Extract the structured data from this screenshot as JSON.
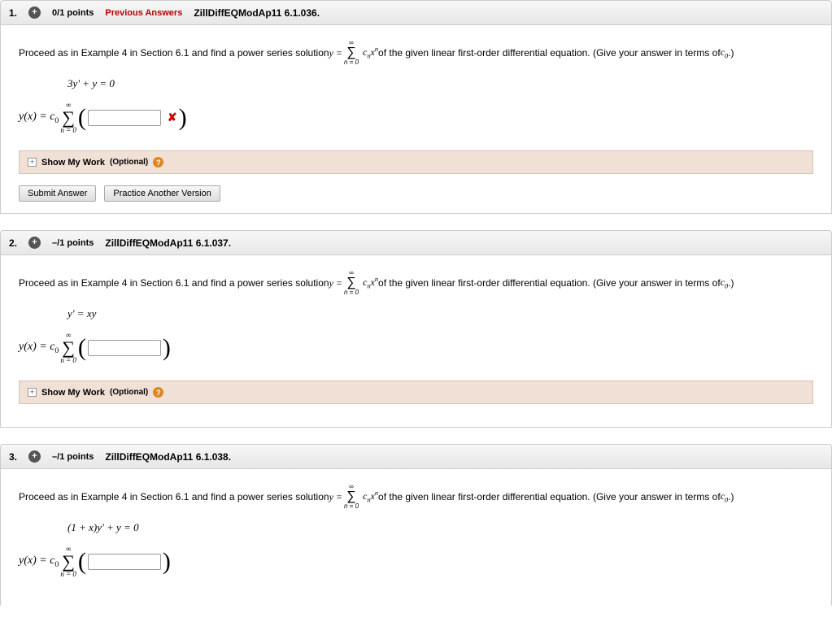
{
  "questions": [
    {
      "number": "1.",
      "points": "0/1 points",
      "previous_answers": "Previous Answers",
      "source": "ZillDiffEQModAp11 6.1.036.",
      "prompt_pre": "Proceed as in Example 4 in Section 6.1 and find a power series solution ",
      "prompt_eq_lhs": "y = ",
      "prompt_sum_top": "∞",
      "prompt_sum_bot": "n = 0",
      "prompt_sum_term": "cₙxⁿ",
      "prompt_post": " of the given linear first-order differential equation. (Give your answer in terms of ",
      "prompt_c0": "c₀",
      "prompt_close": ".)",
      "equation": "3y' + y = 0",
      "answer_prefix": "y(x) = c₀",
      "answer_status": "wrong",
      "show_work_label": "Show My Work",
      "show_work_opt": "(Optional)",
      "submit_label": "Submit Answer",
      "practice_label": "Practice Another Version"
    },
    {
      "number": "2.",
      "points": "–/1 points",
      "previous_answers": "",
      "source": "ZillDiffEQModAp11 6.1.037.",
      "prompt_pre": "Proceed as in Example 4 in Section 6.1 and find a power series solution ",
      "prompt_eq_lhs": "y = ",
      "prompt_sum_top": "∞",
      "prompt_sum_bot": "n = 0",
      "prompt_sum_term": "cₙxⁿ",
      "prompt_post": " of the given linear first-order differential equation. (Give your answer in terms of ",
      "prompt_c0": "c₀",
      "prompt_close": ".)",
      "equation": "y' = xy",
      "answer_prefix": "y(x) = c₀",
      "answer_status": "none",
      "show_work_label": "Show My Work",
      "show_work_opt": "(Optional)",
      "submit_label": "",
      "practice_label": ""
    },
    {
      "number": "3.",
      "points": "–/1 points",
      "previous_answers": "",
      "source": "ZillDiffEQModAp11 6.1.038.",
      "prompt_pre": "Proceed as in Example 4 in Section 6.1 and find a power series solution ",
      "prompt_eq_lhs": "y = ",
      "prompt_sum_top": "∞",
      "prompt_sum_bot": "n = 0",
      "prompt_sum_term": "cₙxⁿ",
      "prompt_post": " of the given linear first-order differential equation. (Give your answer in terms of ",
      "prompt_c0": "c₀",
      "prompt_close": ".)",
      "equation": "(1 + x)y' + y = 0",
      "answer_prefix": "y(x) = c₀",
      "answer_status": "none",
      "show_work_label": "",
      "show_work_opt": "",
      "submit_label": "",
      "practice_label": ""
    }
  ],
  "shared": {
    "sum_top": "∞",
    "sum_bot": "n = 0"
  }
}
